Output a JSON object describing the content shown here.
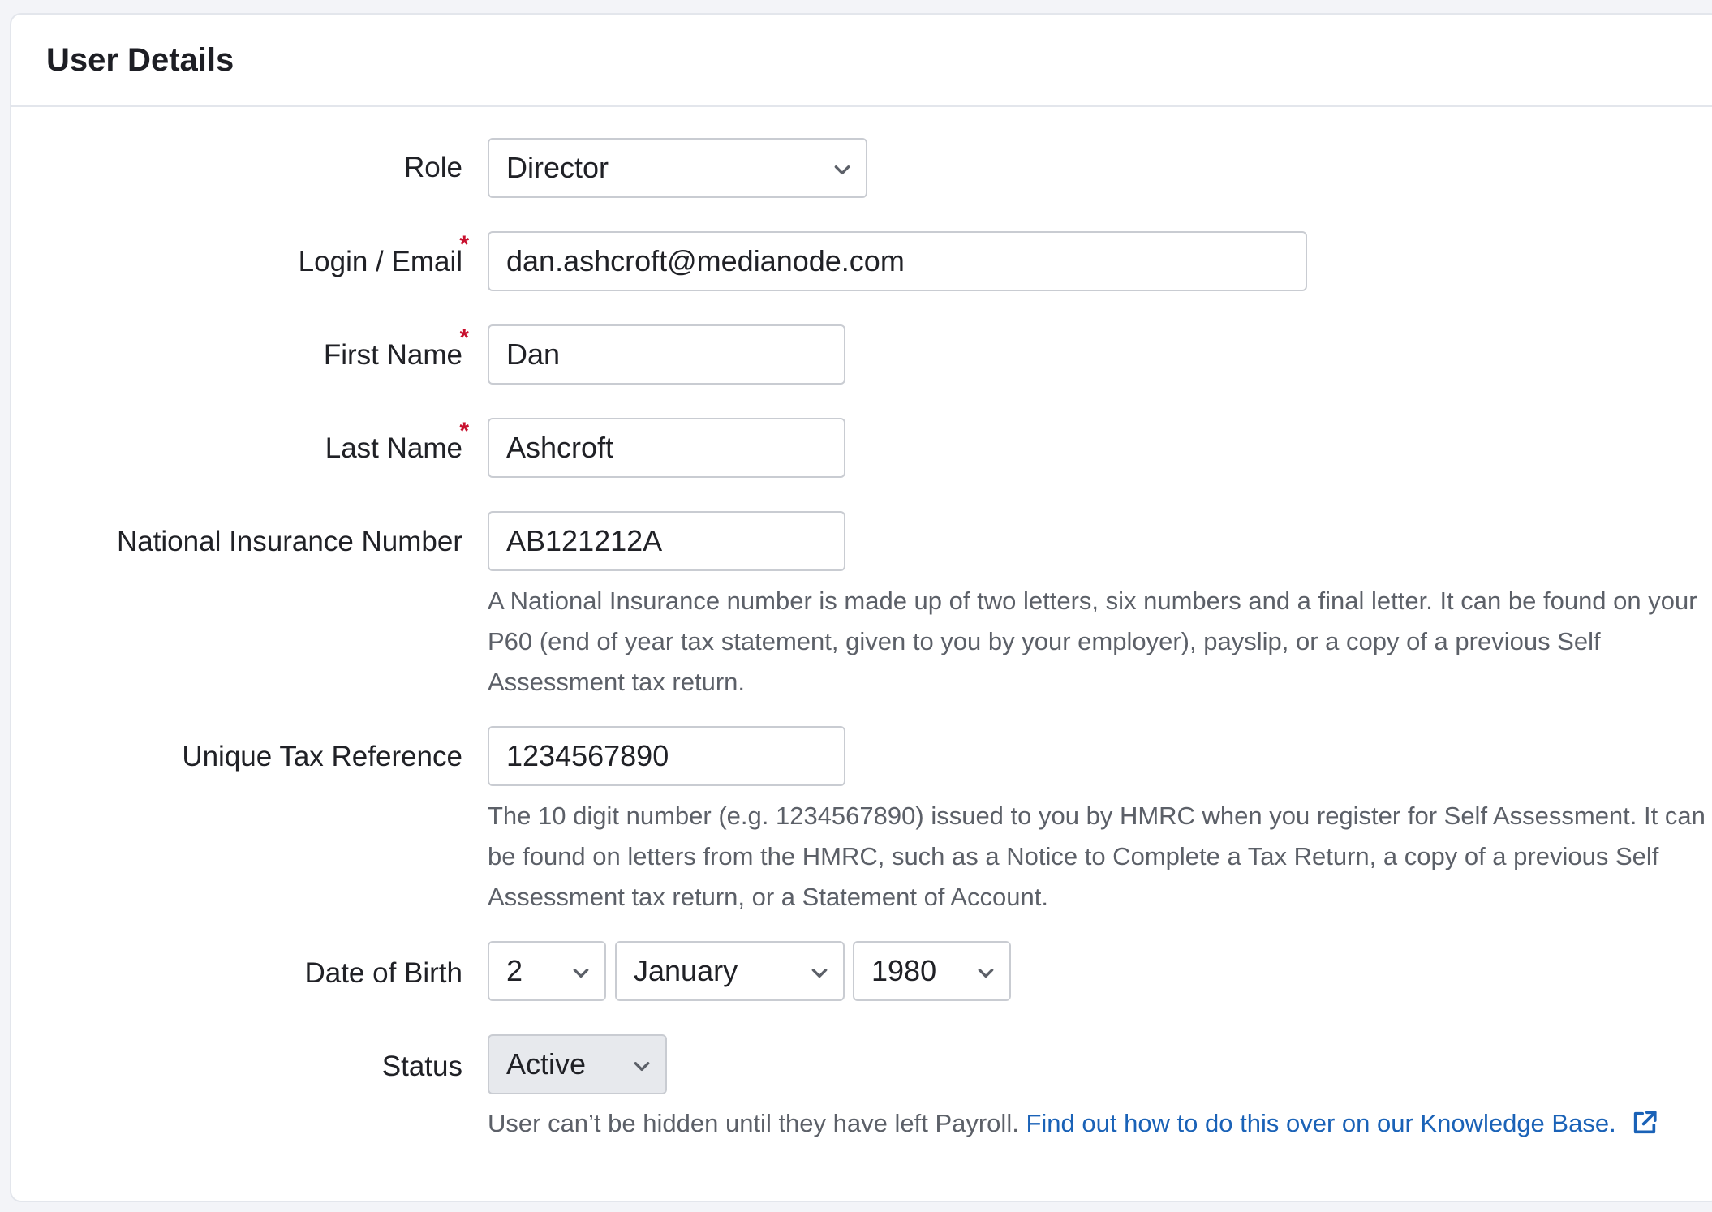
{
  "panel": {
    "title": "User Details"
  },
  "form": {
    "role": {
      "label": "Role",
      "value": "Director",
      "icon": "chevron-down-icon"
    },
    "email": {
      "label": "Login / Email",
      "required_mark": "*",
      "value": "dan.ashcroft@medianode.com"
    },
    "first_name": {
      "label": "First Name",
      "required_mark": "*",
      "value": "Dan"
    },
    "last_name": {
      "label": "Last Name",
      "required_mark": "*",
      "value": "Ashcroft"
    },
    "ni_number": {
      "label": "National Insurance Number",
      "value": "AB121212A",
      "help": "A National Insurance number is made up of two letters, six numbers and a final letter. It can be found on your P60 (end of year tax statement, given to you by your employer), payslip, or a copy of a previous Self Assessment tax return."
    },
    "utr": {
      "label": "Unique Tax Reference",
      "value": "1234567890",
      "help": "The 10 digit number (e.g. 1234567890) issued to you by HMRC when you register for Self Assessment. It can be found on letters from the HMRC, such as a Notice to Complete a Tax Return, a copy of a previous Self Assessment tax return, or a Statement of Account."
    },
    "dob": {
      "label": "Date of Birth",
      "day": "2",
      "month": "January",
      "year": "1980"
    },
    "status": {
      "label": "Status",
      "value": "Active",
      "disabled": true,
      "help_text": "User can’t be hidden until they have left Payroll.",
      "help_link": "Find out how to do this over on our Knowledge Base.",
      "link_icon": "external-link-icon"
    }
  },
  "colors": {
    "required": "#c8102e",
    "link": "#1a62b7",
    "border": "#c9ccd2",
    "disabled_bg": "#e7e9ed"
  }
}
